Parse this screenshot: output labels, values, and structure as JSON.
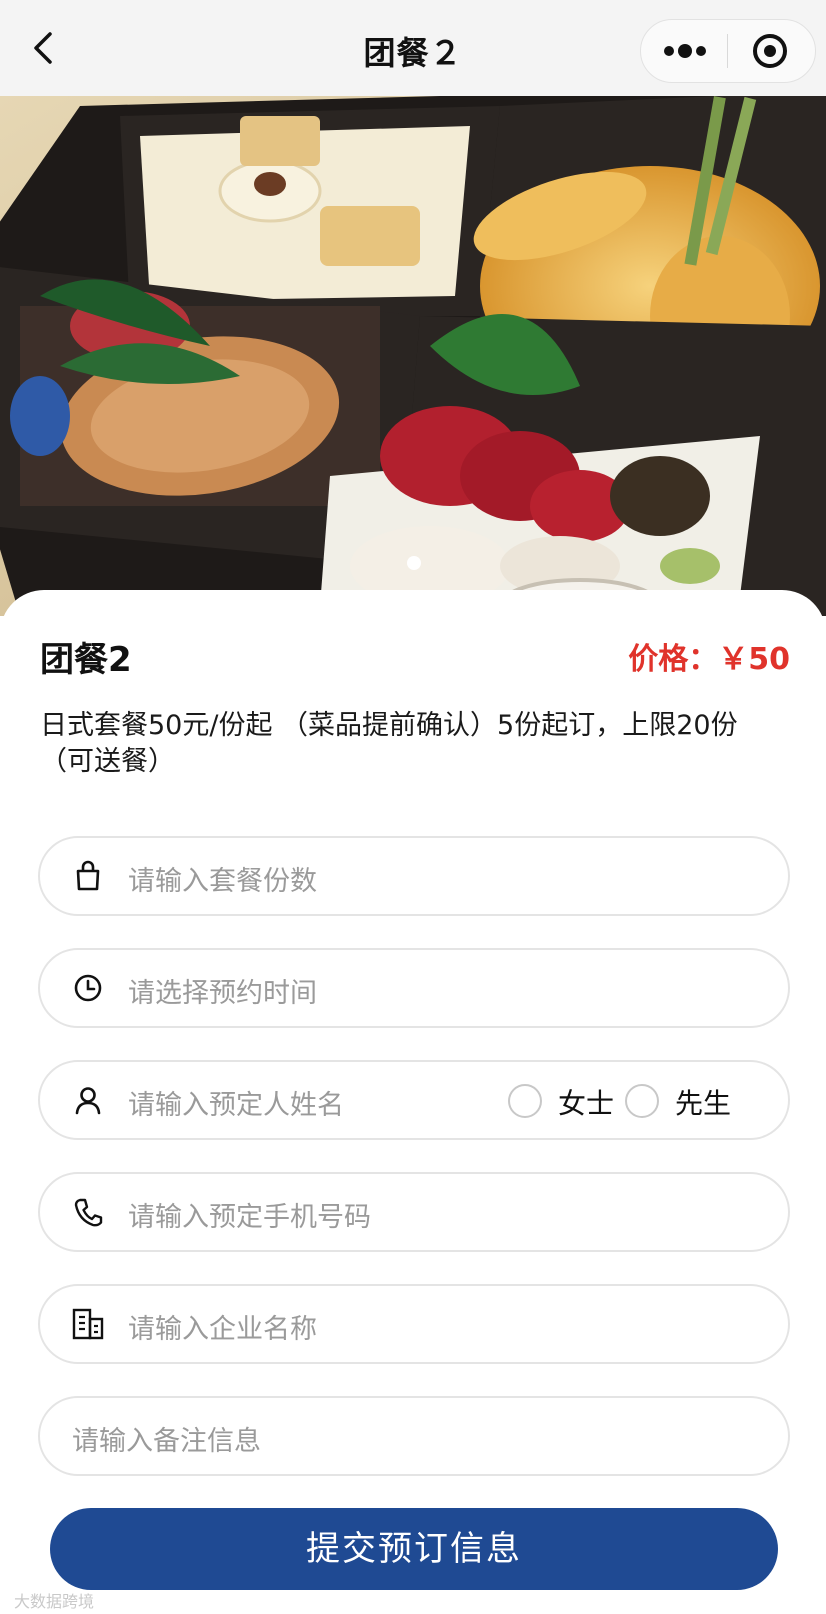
{
  "nav": {
    "title": "团餐２",
    "back_icon": "chevron-left-icon",
    "more_icon": "more-dots-icon",
    "close_icon": "target-close-icon"
  },
  "hero": {
    "image": "japanese-bento-box-photo",
    "carousel_dots": 1
  },
  "product": {
    "name": "团餐2",
    "price": "价格：￥50",
    "description": "日式套餐50元/份起 （菜品提前确认）5份起订，上限20份（可送餐）"
  },
  "form": {
    "quantity_placeholder": "请输入套餐份数",
    "time_placeholder": "请选择预约时间",
    "name_placeholder": "请输入预定人姓名",
    "gender_female": "女士",
    "gender_male": "先生",
    "phone_placeholder": "请输入预定手机号码",
    "company_placeholder": "请输入企业名称",
    "remark_placeholder": "请输入备注信息"
  },
  "submit_label": "提交预订信息",
  "watermark": "大数据跨境",
  "colors": {
    "price": "#e0332b",
    "button": "#1f4a93",
    "placeholder": "#9a9a9a",
    "field_border": "#e4e4e4"
  }
}
